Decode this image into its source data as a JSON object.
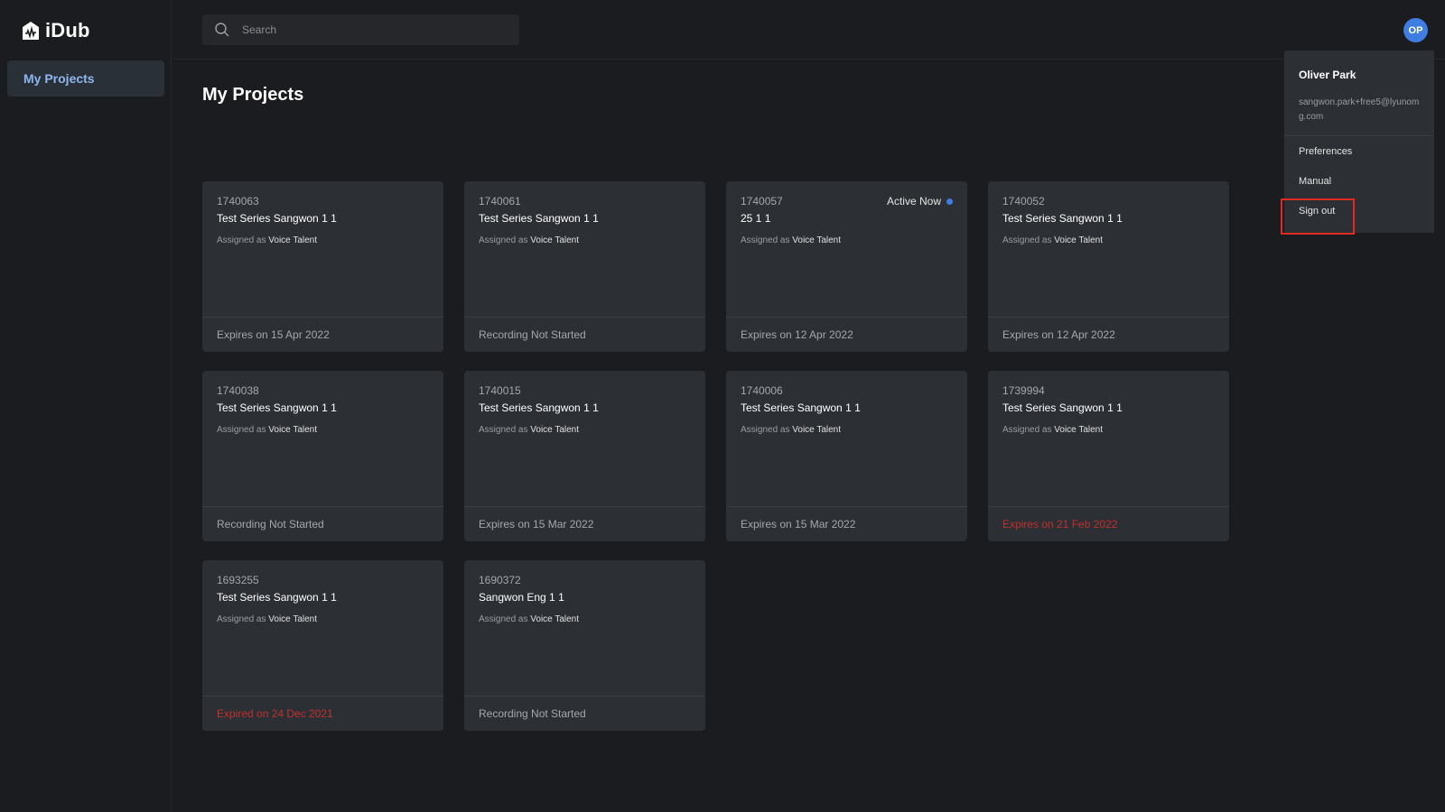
{
  "app": {
    "name": "iDub"
  },
  "sidebar": {
    "items": [
      {
        "label": "My Projects"
      }
    ]
  },
  "search": {
    "placeholder": "Search",
    "value": ""
  },
  "user": {
    "initials": "OP",
    "name": "Oliver Park",
    "email": "sangwon.park+free5@lyunomg.com"
  },
  "menu": {
    "preferences": "Preferences",
    "manual": "Manual",
    "sign_out": "Sign out"
  },
  "main": {
    "title": "My Projects"
  },
  "projects": [
    {
      "id": "1740063",
      "title": "Test Series Sangwon 1 1",
      "assigned_prefix": "Assigned as",
      "role": "Voice Talent",
      "status": "Expires on 15 Apr 2022"
    },
    {
      "id": "1740061",
      "title": "Test Series Sangwon 1 1",
      "assigned_prefix": "Assigned as",
      "role": "Voice Talent",
      "status": "Recording Not Started"
    },
    {
      "id": "1740057",
      "title": "25 1 1",
      "assigned_prefix": "Assigned as",
      "role": "Voice Talent",
      "status": "Expires on 12 Apr 2022",
      "badge": "Active Now"
    },
    {
      "id": "1740052",
      "title": "Test Series Sangwon 1 1",
      "assigned_prefix": "Assigned as",
      "role": "Voice Talent",
      "status": "Expires on 12 Apr 2022"
    },
    {
      "id": "1740038",
      "title": "Test Series Sangwon 1 1",
      "assigned_prefix": "Assigned as",
      "role": "Voice Talent",
      "status": "Recording Not Started"
    },
    {
      "id": "1740015",
      "title": "Test Series Sangwon 1 1",
      "assigned_prefix": "Assigned as",
      "role": "Voice Talent",
      "status": "Expires on 15 Mar 2022"
    },
    {
      "id": "1740006",
      "title": "Test Series Sangwon 1 1",
      "assigned_prefix": "Assigned as",
      "role": "Voice Talent",
      "status": "Expires on 15 Mar 2022"
    },
    {
      "id": "1739994",
      "title": "Test Series Sangwon 1 1",
      "assigned_prefix": "Assigned as",
      "role": "Voice Talent",
      "status": "Expires on 21 Feb 2022",
      "expired": true
    },
    {
      "id": "1693255",
      "title": "Test Series Sangwon 1 1",
      "assigned_prefix": "Assigned as",
      "role": "Voice Talent",
      "status": "Expired on 24 Dec 2021",
      "expired": true
    },
    {
      "id": "1690372",
      "title": "Sangwon Eng 1 1",
      "assigned_prefix": "Assigned as",
      "role": "Voice Talent",
      "status": "Recording Not Started"
    }
  ],
  "colors": {
    "accent": "#3f7de3",
    "expired": "#c0302e",
    "highlight_box": "#e02a22"
  },
  "icons": {
    "logo": "house-waveform-icon",
    "search": "search-icon",
    "active": "blue-dot-icon"
  }
}
